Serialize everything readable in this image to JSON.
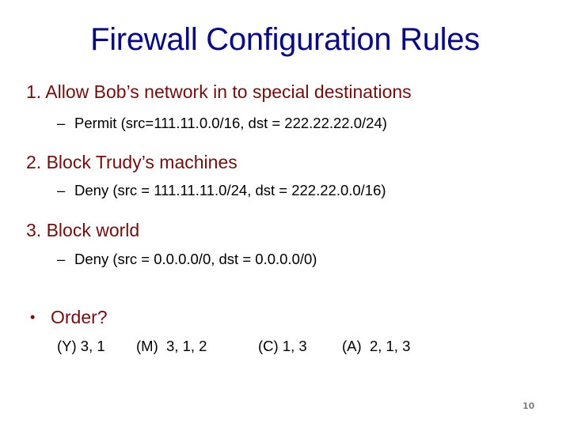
{
  "slide": {
    "title": "Firewall Configuration Rules",
    "rules": [
      {
        "heading": "1. Allow Bob’s network in to special destinations",
        "detail": "Permit (src=111.11.0.0/16, dst = 222.22.22.0/24)"
      },
      {
        "heading": "2. Block Trudy’s machines",
        "detail": "Deny (src = 111.11.11.0/24, dst = 222.22.0.0/16)"
      },
      {
        "heading": "3. Block world",
        "detail": "Deny (src = 0.0.0.0/0, dst = 0.0.0.0/0)"
      }
    ],
    "dash": "–",
    "bullet_symbol": "•",
    "question": "Order?",
    "options": [
      "(Y) 3, 1",
      "(M)  3, 1, 2",
      "(C) 1, 3",
      "(A)  2, 1, 3"
    ],
    "page_number": "10",
    "colors": {
      "title": "#0a0a80",
      "heading": "#6e1010",
      "body": "#000000",
      "page_number": "#808080"
    }
  }
}
